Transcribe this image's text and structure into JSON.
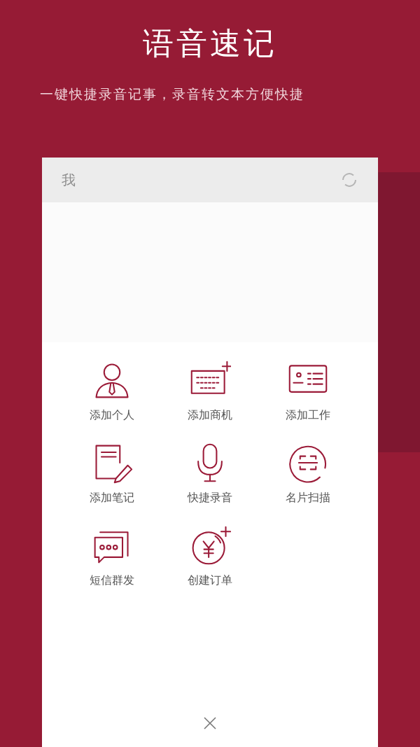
{
  "headline": "语音速记",
  "subtitle": "一键快捷录音记事，录音转文本方便快捷",
  "phone": {
    "header_title": "我"
  },
  "menu": [
    {
      "kind": "person",
      "label": "添加个人"
    },
    {
      "kind": "keyboard",
      "label": "添加商机"
    },
    {
      "kind": "card",
      "label": "添加工作"
    },
    {
      "kind": "note",
      "label": "添加笔记"
    },
    {
      "kind": "mic",
      "label": "快捷录音"
    },
    {
      "kind": "scan",
      "label": "名片扫描"
    },
    {
      "kind": "sms",
      "label": "短信群发"
    },
    {
      "kind": "order",
      "label": "创建订单"
    }
  ]
}
